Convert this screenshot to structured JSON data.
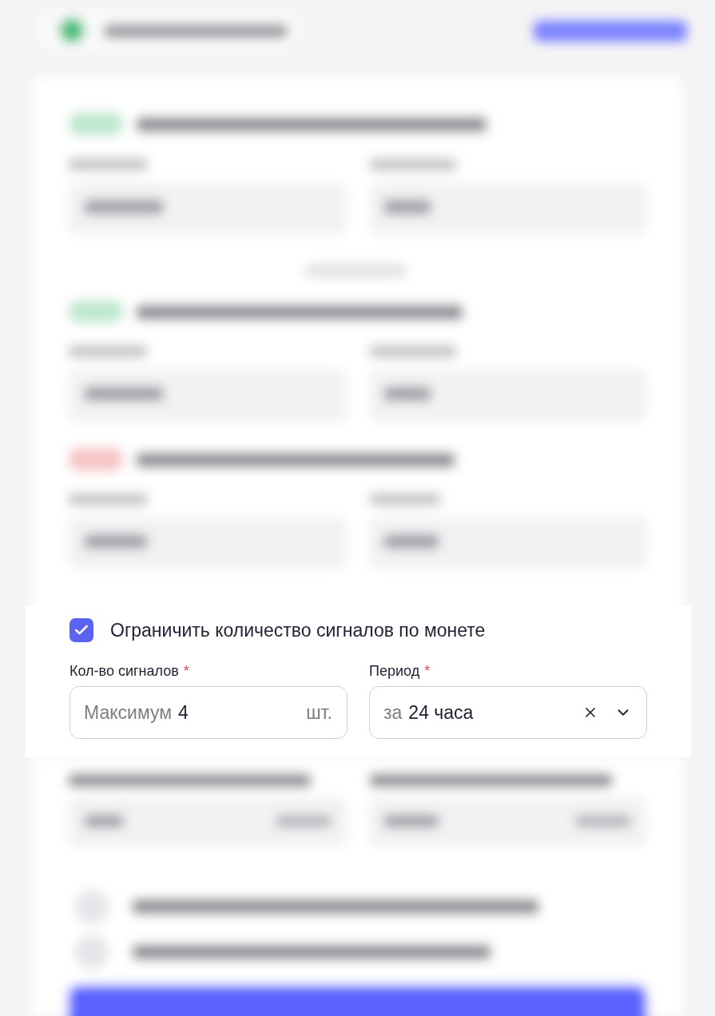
{
  "limit_option": {
    "label": "Ограничить количество сигналов по монете",
    "checked": true
  },
  "fields": [
    {
      "kind": "input",
      "label": "Кол-во сигналов",
      "required_mark": "*",
      "prefix": "Максимум",
      "value": "4",
      "suffix": "шт."
    },
    {
      "kind": "select",
      "label": "Период",
      "required_mark": "*",
      "prefix": "за",
      "value": "24 часа"
    }
  ]
}
